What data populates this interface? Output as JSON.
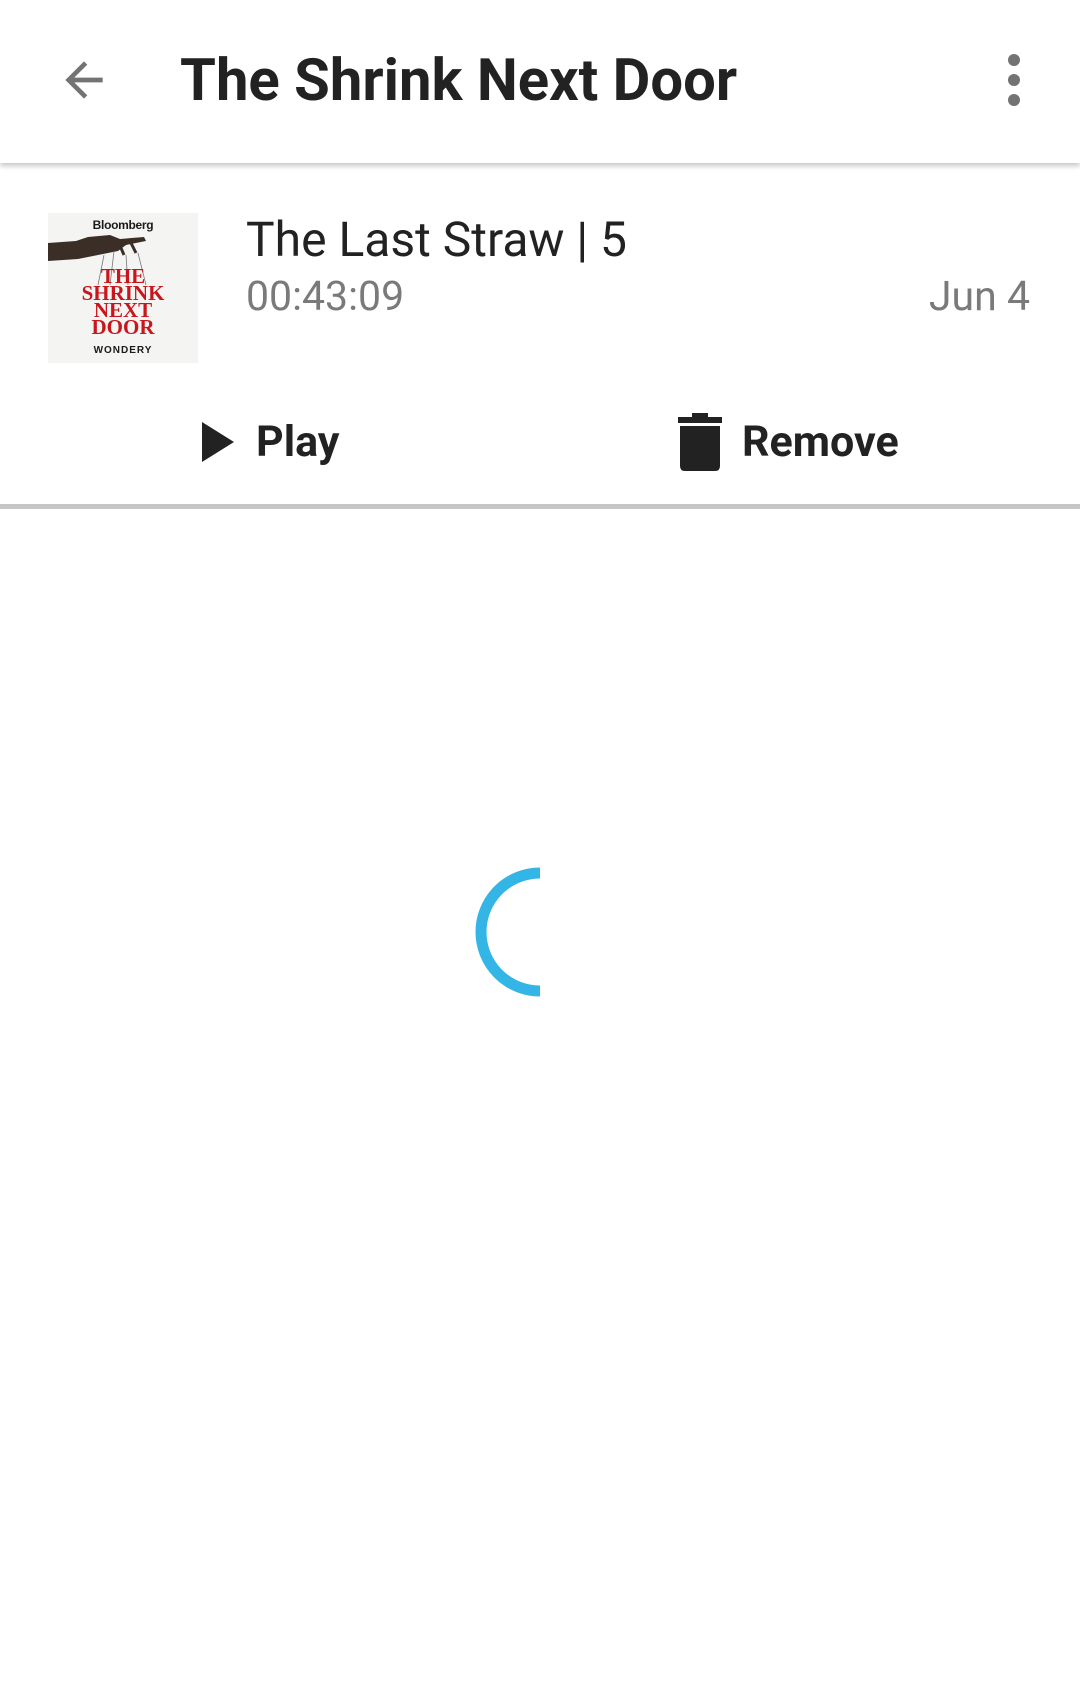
{
  "app_bar": {
    "title": "The Shrink Next Door",
    "back_icon": "arrow-back-icon",
    "menu_icon": "more-vert-icon"
  },
  "episode": {
    "cover": {
      "brand": "Bloomberg",
      "title_lines": [
        "THE",
        "SHRINK",
        "NEXT",
        "DOOR"
      ],
      "publisher": "WONDERY"
    },
    "title": "The Last Straw | 5",
    "duration": "00:43:09",
    "date": "Jun 4",
    "actions": {
      "play_label": "Play",
      "play_icon": "play-icon",
      "remove_label": "Remove",
      "remove_icon": "trash-icon"
    }
  },
  "loading": {
    "spinner_color": "#33b5e5"
  },
  "colors": {
    "title_text": "#222222",
    "secondary_text": "#7a7a7a",
    "divider": "#c6c6c6",
    "cover_red": "#c8161c"
  }
}
